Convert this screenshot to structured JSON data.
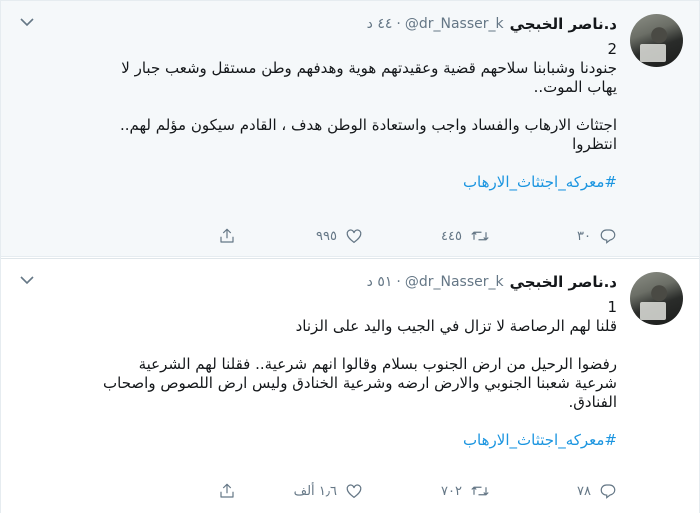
{
  "tweets": [
    {
      "display_name": "د.ناصر الخبجي",
      "handle": "@dr_Nasser_k",
      "dot": "·",
      "time": "٤٤ د",
      "lines": [
        "2",
        "جنودنا وشبابنا سلاحهم قضية وعقيدتهم هوية وهدفهم وطن مستقل وشعب جبار لا",
        "يهاب الموت..",
        "",
        "اجتثاث الارهاب والفساد واجب واستعادة الوطن هدف ، القادم سيكون مؤلم لهم..",
        "انتظروا",
        "",
        "#معركه_اجتثاث_الارهاب"
      ],
      "replies": "٣٠",
      "retweets": "٤٤٥",
      "likes": "٩٩٥"
    },
    {
      "display_name": "د.ناصر الخبجي",
      "handle": "@dr_Nasser_k",
      "dot": "·",
      "time": "٥١ د",
      "lines": [
        "1",
        "قلنا لهم الرصاصة لا تزال في الجيب واليد على الزناد",
        "",
        "رفضوا الرحيل من ارض الجنوب بسلام وقالوا انهم شرعية.. فقلنا لهم الشرعية",
        "شرعية شعبنا الجنوبي والارض ارضه وشرعية الخنادق وليس ارض اللصوص واصحاب",
        "الفنادق.",
        "",
        "#معركه_اجتثاث_الارهاب"
      ],
      "replies": "٧٨",
      "retweets": "٧٠٢",
      "likes": "١٫٦ ألف"
    }
  ],
  "icons": {
    "reply": "reply-icon",
    "retweet": "retweet-icon",
    "like": "heart-icon",
    "share": "share-icon",
    "caret": "chevron-down-icon"
  },
  "colors": {
    "link": "#1b95e0",
    "muted": "#657786",
    "highlight_bg": "#f5f8fa"
  }
}
